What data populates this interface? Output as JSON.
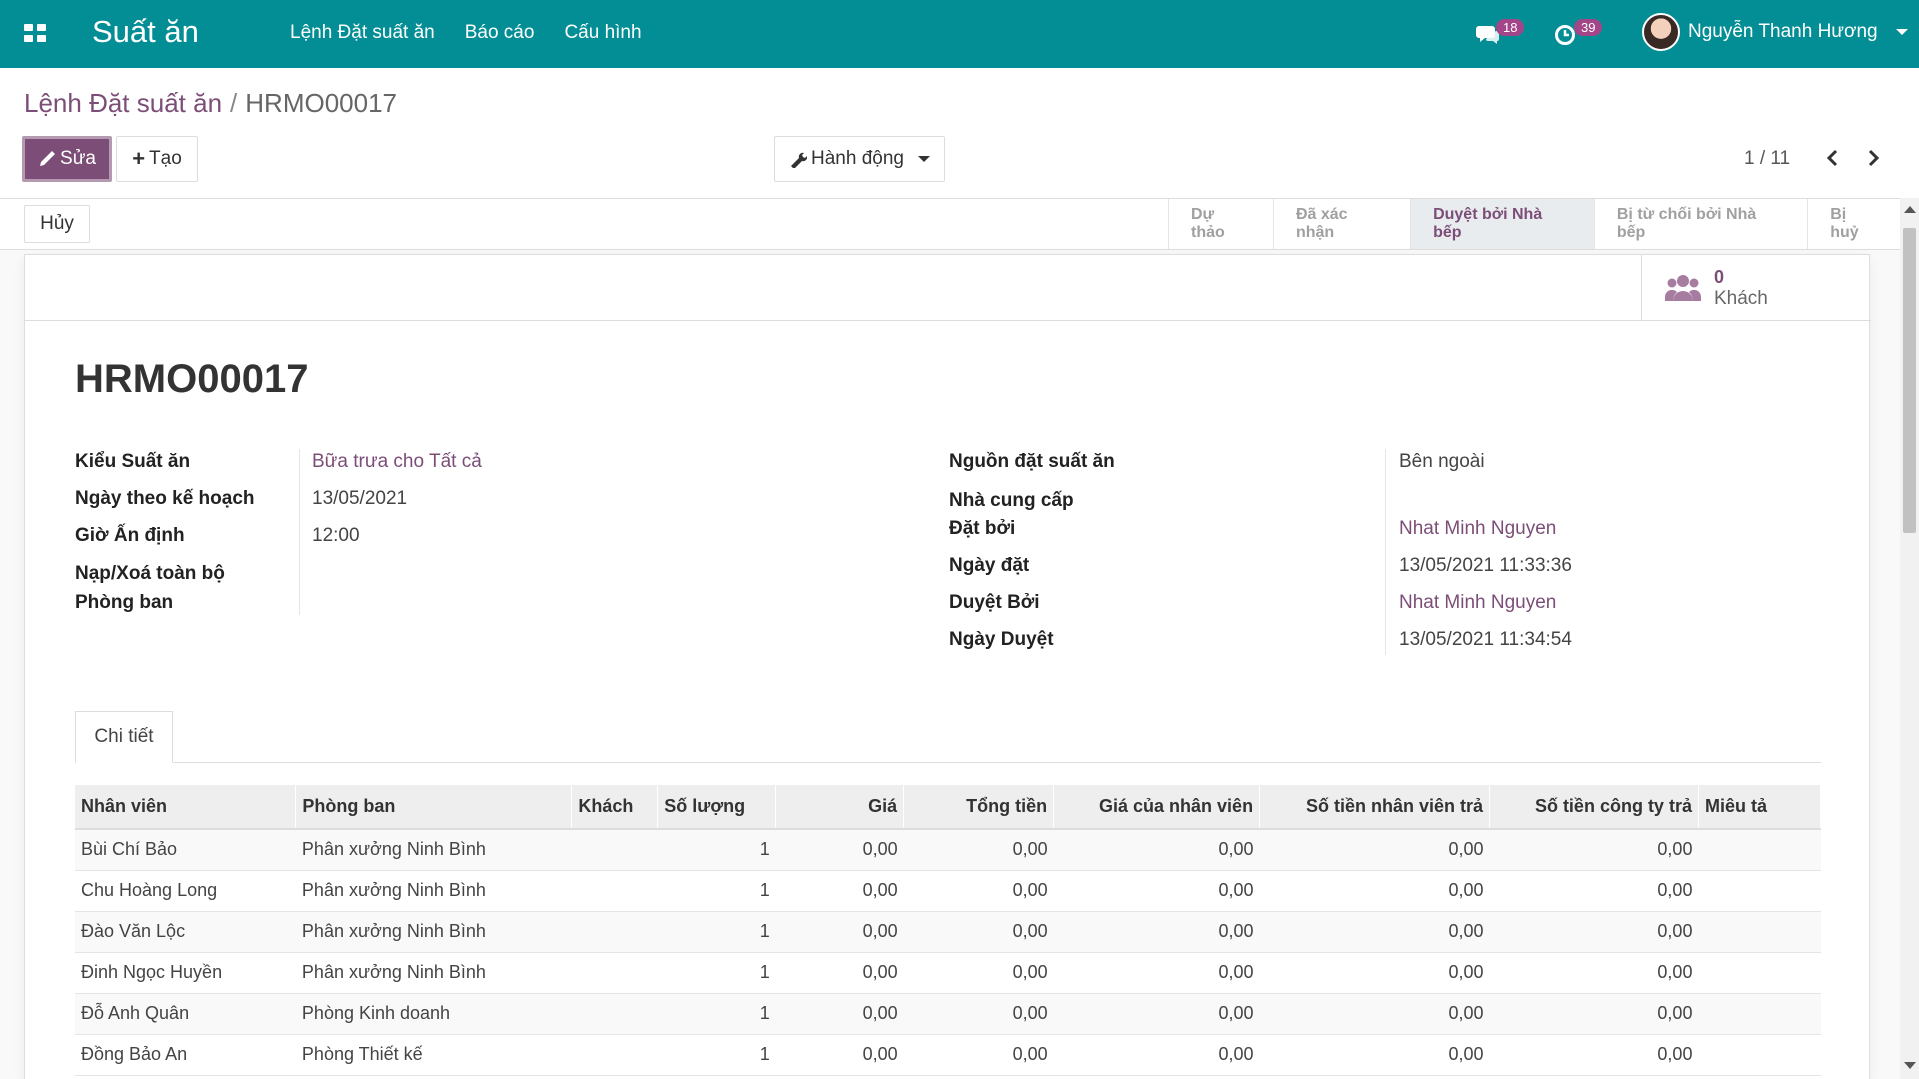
{
  "navbar": {
    "app_name": "Suất ăn",
    "menu": [
      "Lệnh Đặt suất ăn",
      "Báo cáo",
      "Cấu hình"
    ],
    "messages_count": "18",
    "activities_count": "39",
    "user_name": "Nguyễn Thanh Hương"
  },
  "breadcrumb": {
    "parent": "Lệnh Đặt suất ăn",
    "separator": "/",
    "current": "HRMO00017"
  },
  "toolbar": {
    "edit_label": "Sửa",
    "create_label": "Tạo",
    "action_label": "Hành động",
    "pager": "1 / 11"
  },
  "statusbar": {
    "cancel_label": "Hủy",
    "stages": [
      {
        "label": "Dự thảo",
        "active": false
      },
      {
        "label": "Đã xác nhận",
        "active": false
      },
      {
        "label": "Duyệt bởi Nhà bếp",
        "active": true
      },
      {
        "label": "Bị từ chối bởi Nhà bếp",
        "active": false
      },
      {
        "label": "Bị huỷ",
        "active": false
      }
    ]
  },
  "stat_button": {
    "value": "0",
    "label": "Khách"
  },
  "record": {
    "name": "HRMO00017",
    "left_fields": [
      {
        "label": "Kiểu Suất ăn",
        "value": "Bữa trưa cho Tất cả",
        "link": true
      },
      {
        "label": "Ngày theo kế hoạch",
        "value": "13/05/2021",
        "link": false
      },
      {
        "label": "Giờ Ấn định",
        "value": "12:00",
        "link": false
      },
      {
        "label": "Nạp/Xoá toàn bộ",
        "value": "",
        "link": false
      },
      {
        "label": "Phòng ban",
        "value": "",
        "link": false
      }
    ],
    "right_fields": [
      {
        "label": "Nguồn đặt suất ăn",
        "value": "Bên ngoài",
        "link": false
      },
      {
        "label": "Nhà cung cấp",
        "value": "",
        "link": false
      },
      {
        "label": "Đặt bởi",
        "value": "Nhat Minh Nguyen",
        "link": true
      },
      {
        "label": "Ngày đặt",
        "value": "13/05/2021 11:33:36",
        "link": false
      },
      {
        "label": "Duyệt Bởi",
        "value": "Nhat Minh Nguyen",
        "link": true
      },
      {
        "label": "Ngày Duyệt",
        "value": "13/05/2021 11:34:54",
        "link": false
      }
    ]
  },
  "tabs": [
    "Chi tiết"
  ],
  "table": {
    "columns": [
      "Nhân viên",
      "Phòng ban",
      "Khách",
      "Số lượng",
      "Giá",
      "Tổng tiền",
      "Giá của nhân viên",
      "Số tiền nhân viên trả",
      "Số tiền công ty trả",
      "Miêu tả"
    ],
    "rows": [
      [
        "Bùi Chí Bảo",
        "Phân xưởng Ninh Bình",
        "",
        "1",
        "0,00",
        "0,00",
        "0,00",
        "0,00",
        "0,00",
        ""
      ],
      [
        "Chu Hoàng Long",
        "Phân xưởng Ninh Bình",
        "",
        "1",
        "0,00",
        "0,00",
        "0,00",
        "0,00",
        "0,00",
        ""
      ],
      [
        "Đào Văn Lộc",
        "Phân xưởng Ninh Bình",
        "",
        "1",
        "0,00",
        "0,00",
        "0,00",
        "0,00",
        "0,00",
        ""
      ],
      [
        "Đinh Ngọc Huyền",
        "Phân xưởng Ninh Bình",
        "",
        "1",
        "0,00",
        "0,00",
        "0,00",
        "0,00",
        "0,00",
        ""
      ],
      [
        "Đỗ Anh Quân",
        "Phòng Kinh doanh",
        "",
        "1",
        "0,00",
        "0,00",
        "0,00",
        "0,00",
        "0,00",
        ""
      ],
      [
        "Đồng Bảo An",
        "Phòng Thiết kế",
        "",
        "1",
        "0,00",
        "0,00",
        "0,00",
        "0,00",
        "0,00",
        ""
      ]
    ]
  },
  "colors": {
    "navbar": "#038e95",
    "primary": "#7c4e77",
    "badge": "#a24689"
  }
}
